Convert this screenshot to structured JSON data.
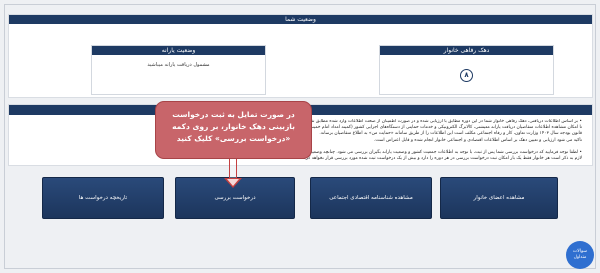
{
  "status_panel": {
    "title": "وضعیت شما",
    "cards": {
      "subsidy_status": {
        "title": "وضعیت یارانه",
        "text": "مشمول دریافت یارانه میباشید"
      },
      "welfare_decile": {
        "title": "دهک رفاهی خانوار",
        "value": "۸"
      }
    }
  },
  "info_panel": {
    "lines": [
      "• بر اساس اطلاعات دریافتی، دهک رفاهی خانوار شما در این دوره مطابق با ارزیابی شده و در صورت اطمینان از صحت اطلاعات وارد شده مطابق شرایط اعلام شده یارانه دریافت می کنید.",
      "تا امکان مشاهده اطلاعات متقاضیان دریافت یارانه معیشتی، کالابرگ الکترونیکی و خدمات حمایتی از دستگاه‌های اجرایی کشور (کمیته امداد امام خمینی (ره)، سازمان بهزیستی و ...) فراهم شود.",
      "قانون بودجه سال ۱۴۰۳ وزارت تعاون، کار و رفاه اجتماعی مکلف است این اطلاعات را از طریق سامانه «حمایت من» به اطلاع متقاضیان برساند.",
      "تاکید می شود ارزیابی و تعیین دهک بر اساس اطلاعات اقتصادی و اجتماعی خانوار انجام شده و قابل اعتراض است.",
      "",
      "• لطفا توجه فرمایید که درخواست بررسی شما پس از ثبت، با توجه به اطلاعات جمعیت کشور و وضعیت یارانه بگیران بررسی می شود. چنانچه وضعیت شما تغییر کند، نتیجه از طریق پیامک اطلاع رسانی می شود.",
      "لازم به ذکر است هر خانوار فقط یک بار امکان ثبت درخواست بررسی در هر دوره را دارد و بیش از یک درخواست ثبت شده مورد بررسی قرار نخواهد گرفت."
    ]
  },
  "buttons": {
    "view_members": "مشاهده اعضای خانوار",
    "socio_economic_id": "مشاهده شناسنامه اقتصادی اجتماعی",
    "request_review": "درخواست بررسی",
    "request_history": "تاریخچه درخواست ها"
  },
  "callout": {
    "lines": [
      "در صورت تمایل به ثبت درخواست",
      "بازبینی دهک خانوار، بر روی دکمه",
      "«درخواست بررسی» کلیک کنید"
    ]
  },
  "help_chip": {
    "line1": "سوالات",
    "line2": "متداول"
  },
  "colors": {
    "header_navy": "#1e3a63",
    "callout_red": "#c8656a",
    "help_blue": "#2f6fd0"
  }
}
